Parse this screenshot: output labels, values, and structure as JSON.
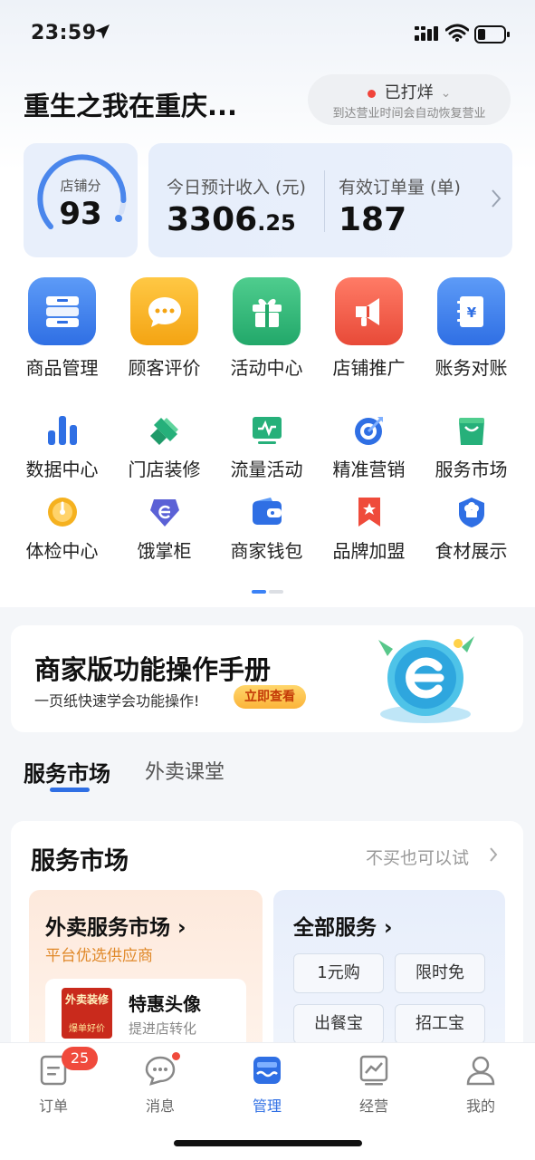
{
  "status_bar": {
    "time": "23:59"
  },
  "header": {
    "store_name": "重生之我在重庆...",
    "status_label": "已打烊",
    "status_sub": "到达营业时间会自动恢复营业"
  },
  "score": {
    "label": "店铺分",
    "value": "93",
    "level_fraction": 0.93
  },
  "revenue": {
    "label": "今日预计收入 (元)",
    "value_int": "3306",
    "value_dec": ".25",
    "orders_label": "有效订单量 (单)",
    "orders_value": "187"
  },
  "big_grid": [
    {
      "label": "商品管理",
      "icon": "product-manage-icon",
      "color": "#3b7ff0"
    },
    {
      "label": "顾客评价",
      "icon": "comment-icon",
      "color": "#f5b11f"
    },
    {
      "label": "活动中心",
      "icon": "gift-icon",
      "color": "#2fb87a"
    },
    {
      "label": "店铺推广",
      "icon": "megaphone-icon",
      "color": "#ef5a47"
    },
    {
      "label": "账务对账",
      "icon": "ledger-icon",
      "color": "#3b7ff0"
    }
  ],
  "small_grid": [
    {
      "label": "数据中心",
      "icon": "bar-chart-icon"
    },
    {
      "label": "门店装修",
      "icon": "brush-icon"
    },
    {
      "label": "流量活动",
      "icon": "monitor-icon"
    },
    {
      "label": "精准营销",
      "icon": "target-icon"
    },
    {
      "label": "服务市场",
      "icon": "shopping-bag-icon"
    },
    {
      "label": "体检中心",
      "icon": "gauge-icon"
    },
    {
      "label": "饿掌柜",
      "icon": "eleme-icon"
    },
    {
      "label": "商家钱包",
      "icon": "wallet-icon"
    },
    {
      "label": "品牌加盟",
      "icon": "bookmark-icon"
    },
    {
      "label": "食材展示",
      "icon": "chef-hat-icon"
    }
  ],
  "banner": {
    "title": "商家版功能操作手册",
    "subtitle": "一页纸快速学会功能操作!",
    "button": "立即查看"
  },
  "tabs": [
    {
      "label": "服务市场"
    },
    {
      "label": "外卖课堂"
    }
  ],
  "market": {
    "title": "服务市场",
    "more": "不买也可以试",
    "left": {
      "title": "外卖服务市场",
      "subtitle": "平台优选供应商",
      "product_title": "特惠头像",
      "product_sub": "提进店转化",
      "thumb_text1": "外卖装修",
      "thumb_text2": "爆单好价"
    },
    "right": {
      "title": "全部服务",
      "chips": [
        "1元购",
        "限时免",
        "出餐宝",
        "招工宝"
      ]
    }
  },
  "nav": [
    {
      "label": "订单",
      "badge": "25"
    },
    {
      "label": "消息"
    },
    {
      "label": "管理"
    },
    {
      "label": "经营"
    },
    {
      "label": "我的"
    }
  ]
}
